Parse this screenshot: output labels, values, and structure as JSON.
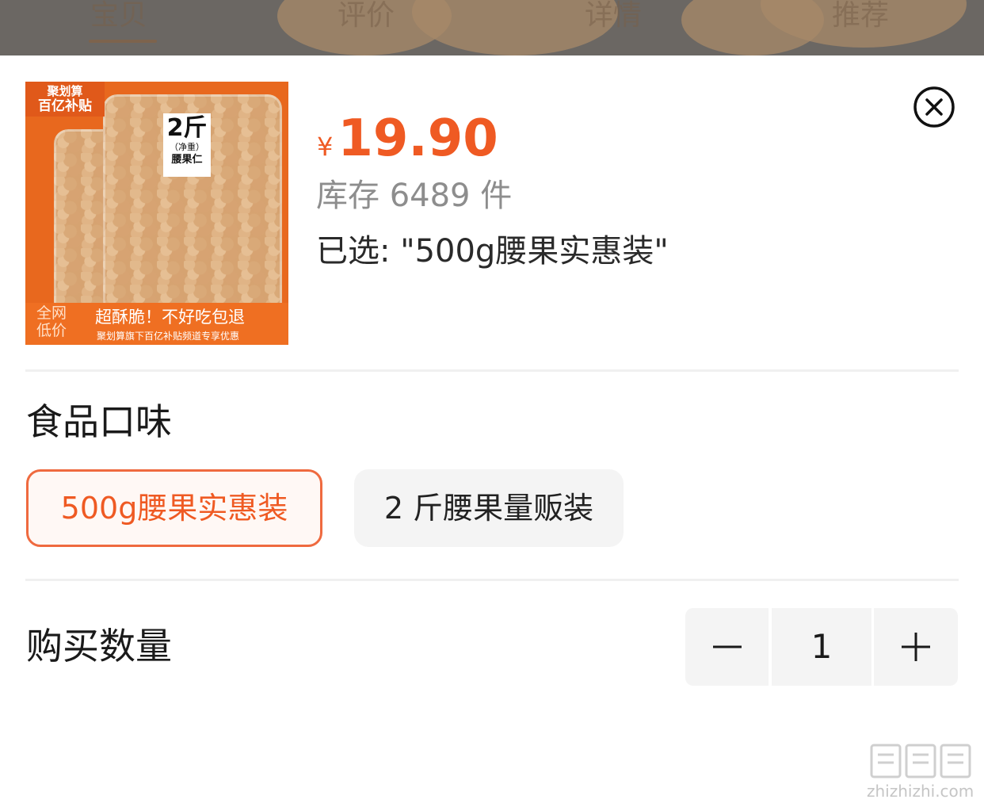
{
  "top_tabs": [
    {
      "label": "宝贝",
      "active": true
    },
    {
      "label": "评价",
      "active": false
    },
    {
      "label": "详情",
      "active": false
    },
    {
      "label": "推荐",
      "active": false
    }
  ],
  "product_image": {
    "badge_line1": "聚划算",
    "badge_line2": "百亿补贴",
    "weight_main": "2斤",
    "weight_sub": "（净重）",
    "weight_name": "腰果仁",
    "bottom_tag": "全网低价",
    "bottom_slogan": "超酥脆！不好吃包退",
    "bottom_note": "聚划算旗下百亿补贴频道专享优惠"
  },
  "price": {
    "currency": "¥",
    "value": "19.90",
    "color": "#ef5a23"
  },
  "stock_text": "库存 6489 件",
  "selected_text": "已选: \"500g腰果实惠装\"",
  "flavor_section": {
    "title": "食品口味",
    "options": [
      {
        "label": "500g腰果实惠装",
        "selected": true
      },
      {
        "label": "2 斤腰果量贩装",
        "selected": false
      }
    ]
  },
  "quantity_section": {
    "title": "购买数量",
    "value": "1"
  },
  "icons": {
    "close": "close-circle-icon",
    "minus": "minus-icon",
    "plus": "plus-icon"
  },
  "watermark": {
    "url": "zhizhizhi.com"
  },
  "colors": {
    "accent": "#ef5a23",
    "chip_border": "#ef6a3f",
    "chip_bg_selected": "#fff8f5",
    "chip_bg_normal": "#f4f4f4",
    "stock_grey": "#8d8d8d"
  }
}
